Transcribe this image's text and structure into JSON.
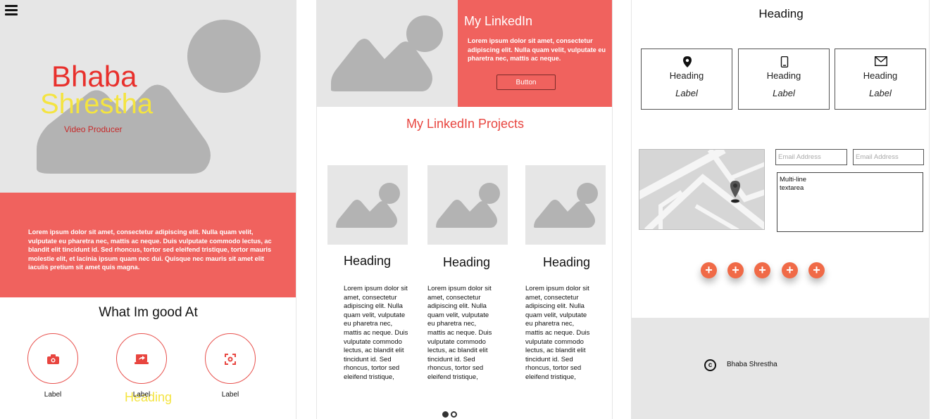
{
  "panel1": {
    "menu_icon": "hamburger-menu-icon",
    "hero": {
      "first_name": "Bhaba",
      "last_name": "Shrestha",
      "role": "Video Producer"
    },
    "section": {
      "heading": "Heading",
      "body": "Lorem ipsum dolor sit amet, consectetur adipiscing elit. Nulla quam velit, vulputate eu pharetra nec, mattis ac neque. Duis vulputate commodo lectus, ac blandit elit tincidunt id. Sed rhoncus, tortor sed eleifend tristique, tortor mauris molestie elit, et lacinia ipsum quam nec dui. Quisque nec mauris sit amet elit iaculis pretium sit amet quis magna."
    },
    "skills_heading": "What Im good At",
    "skills": [
      {
        "icon": "camera-icon",
        "label": "Label"
      },
      {
        "icon": "laptop-share-icon",
        "label": "Label"
      },
      {
        "icon": "focus-capture-icon",
        "label": "Label"
      }
    ]
  },
  "panel2": {
    "title": "My LinkedIn",
    "text": "Lorem ipsum dolor sit amet, consectetur adipiscing elit. Nulla quam velit, vulputate eu pharetra nec, mattis ac neque.",
    "button": "Button",
    "projects_title": "My LinkedIn Projects",
    "projects": [
      {
        "heading": "Heading",
        "text": "Lorem ipsum dolor sit amet, consectetur adipiscing elit. Nulla quam velit, vulputate eu pharetra nec, mattis ac neque. Duis vulputate commodo lectus, ac blandit elit tincidunt id. Sed rhoncus, tortor sed eleifend tristique,"
      },
      {
        "heading": "Heading",
        "text": "Lorem ipsum dolor sit amet, consectetur adipiscing elit. Nulla quam velit, vulputate eu pharetra nec, mattis ac neque. Duis vulputate commodo lectus, ac blandit elit tincidunt id. Sed rhoncus, tortor sed eleifend tristique,"
      },
      {
        "heading": "Heading",
        "text": "Lorem ipsum dolor sit amet, consectetur adipiscing elit. Nulla quam velit, vulputate eu pharetra nec, mattis ac neque. Duis vulputate commodo lectus, ac blandit elit tincidunt id. Sed rhoncus, tortor sed eleifend tristique,"
      }
    ],
    "pagination": {
      "pages": 2,
      "current": 1
    }
  },
  "panel3": {
    "heading": "Heading",
    "cards": [
      {
        "icon": "map-pin-icon",
        "heading": "Heading",
        "label": "Label"
      },
      {
        "icon": "smartphone-icon",
        "heading": "Heading",
        "label": "Label"
      },
      {
        "icon": "envelope-icon",
        "heading": "Heading",
        "label": "Label"
      }
    ],
    "form": {
      "email_placeholder_1": "Email Address",
      "email_placeholder_2": "Email Address",
      "textarea_value": "Multi-line\ntextarea"
    },
    "add_buttons": [
      "+",
      "+",
      "+",
      "+",
      "+"
    ],
    "footer": {
      "copyright_symbol": "c",
      "name": "Bhaba Shrestha"
    }
  },
  "colors": {
    "accent_red": "#f0625e",
    "name_red": "#e8302c",
    "name_yellow": "#f4e440",
    "plus_orange": "#f06a47",
    "placeholder_gray": "#e6e6e6"
  }
}
